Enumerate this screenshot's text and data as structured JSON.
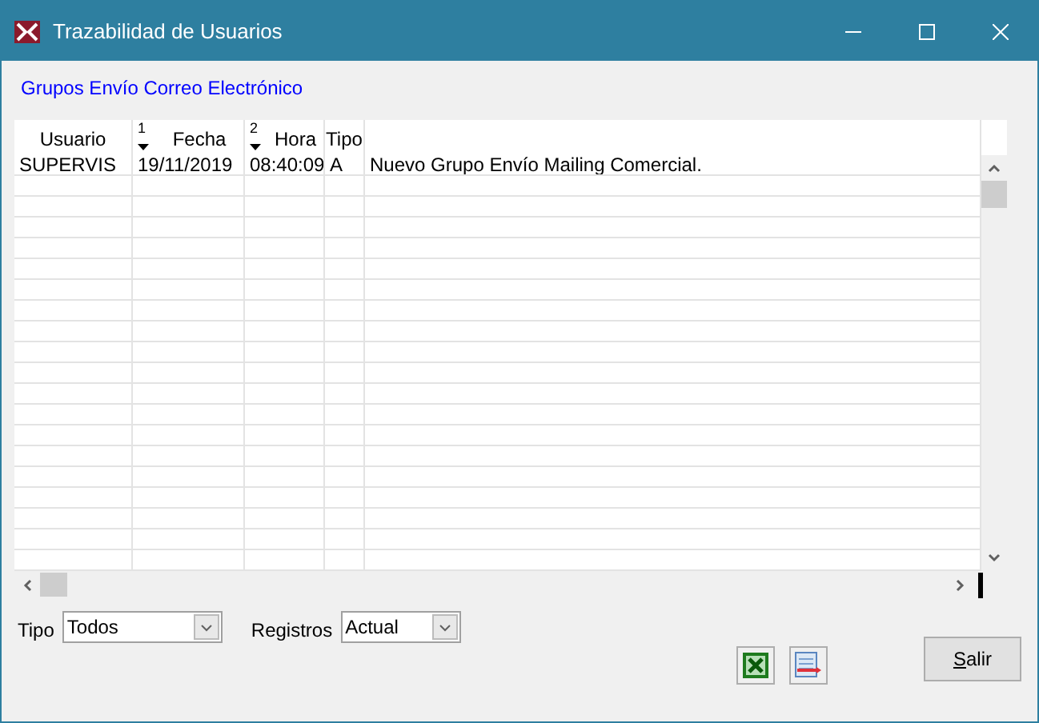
{
  "window": {
    "title": "Trazabilidad de Usuarios"
  },
  "group_link": "Grupos Envío Correo Electrónico",
  "table": {
    "columns": [
      {
        "label": "Usuario"
      },
      {
        "label": "Fecha",
        "sort_order": "1"
      },
      {
        "label": "Hora",
        "sort_order": "2"
      },
      {
        "label": "Tipo"
      },
      {}
    ],
    "rows": [
      [
        "SUPERVIS",
        "19/11/2019",
        "08:40:09",
        "A",
        "Nuevo Grupo Envío Mailing Comercial."
      ]
    ]
  },
  "filters": [
    {
      "label": "Tipo",
      "value": "Todos"
    },
    {
      "label": "Registros",
      "value": "Actual"
    }
  ],
  "exit_button": {
    "label": "Salir"
  }
}
